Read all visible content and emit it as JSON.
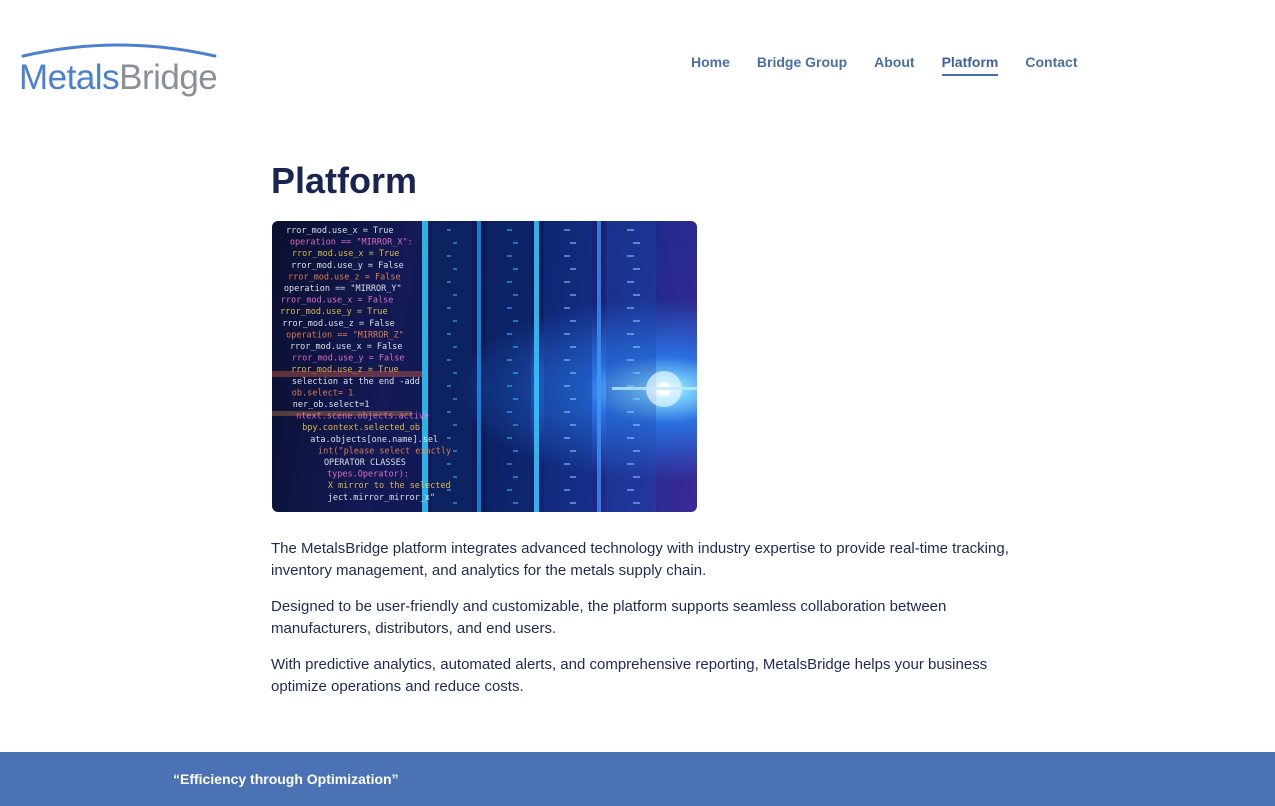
{
  "header": {
    "logo": {
      "part1": "Metals",
      "part2": "Bridge"
    },
    "nav": [
      {
        "label": "Home"
      },
      {
        "label": "Bridge Group"
      },
      {
        "label": "About"
      },
      {
        "label": "Platform",
        "active": true
      },
      {
        "label": "Contact"
      }
    ]
  },
  "main": {
    "title": "Platform",
    "hero_image": {
      "code_lines": [
        "rror_mod.use_x = True",
        "operation == \"MIRROR_X\":",
        "rror_mod.use_x = True",
        "rror_mod.use_y = False",
        "rror_mod.use_z = False",
        "operation == \"MIRROR_Y\"",
        "rror_mod.use_x = False",
        "rror_mod.use_y = True",
        "rror_mod.use_z = False",
        "operation == \"MIRROR_Z\"",
        "rror_mod.use_x = False",
        "rror_mod.use_y = False",
        "rror_mod.use_z = True",
        "selection at the end -add",
        "ob.select= 1",
        "ner_ob.select=1",
        "ntext.scene.objects.active",
        "bpy.context.selected_ob",
        "ata.objects[one.name].sel",
        "int(\"please select exactly",
        "OPERATOR CLASSES",
        "types.Operator):",
        "X mirror to the selected",
        "ject.mirror_mirror_x\""
      ]
    },
    "paragraphs": [
      "The MetalsBridge platform integrates advanced technology with industry expertise to provide real-time tracking, inventory management, and analytics for the metals supply chain.",
      "Designed to be user-friendly and customizable, the platform supports seamless collaboration between manufacturers, distributors, and end users.",
      "With predictive analytics, automated alerts, and comprehensive reporting, MetalsBridge helps your business optimize operations and reduce costs."
    ]
  },
  "footer": {
    "quote": "“Efficiency through Optimization”"
  },
  "colors": {
    "nav_link": "#4a6ea8",
    "title": "#1a2451",
    "footer_bg": "#4a72b5",
    "logo_blue": "#4c7fd1",
    "logo_gray": "#8a8f98"
  }
}
